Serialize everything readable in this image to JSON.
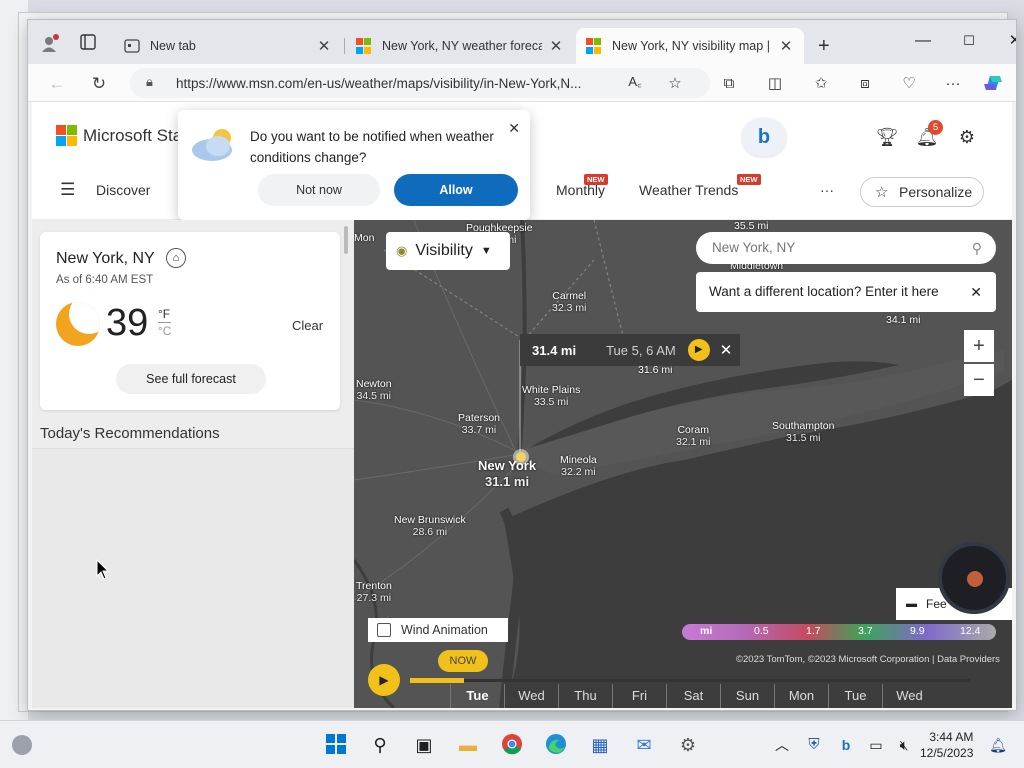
{
  "browser": {
    "tabs": [
      {
        "label": "New tab",
        "active": false
      },
      {
        "label": "New York, NY weather forecast",
        "active": false
      },
      {
        "label": "New York, NY visibility map | M",
        "active": true
      }
    ],
    "url": "https://www.msn.com/en-us/weather/maps/visibility/in-New-York,N..."
  },
  "header": {
    "logo_text": "Microsoft Sta",
    "notification_count": "5",
    "nav": [
      {
        "label": "Discover"
      },
      {
        "label": "Monthly",
        "tag": "NEW"
      },
      {
        "label": "Weather Trends",
        "tag": "NEW"
      }
    ],
    "more": "···",
    "personalize_label": "Personalize"
  },
  "notification_popup": {
    "message": "Do you want to be notified when weather conditions change?",
    "decline_label": "Not now",
    "accept_label": "Allow"
  },
  "weather_card": {
    "city": "New York, NY",
    "as_of": "As of 6:40 AM EST",
    "temperature": "39",
    "unit_f": "°F",
    "unit_c": "°C",
    "condition": "Clear",
    "forecast_button": "See full forecast"
  },
  "recommendations_title": "Today's Recommendations",
  "map": {
    "layer_label": "Visibility",
    "search_placeholder": "New York, NY",
    "location_tip": "Want a different location? Enter it here",
    "readout": {
      "value": "31.4 mi",
      "time": "Tue 5, 6 AM"
    },
    "cities": [
      {
        "name": "Poughkeepsie",
        "value": "35.2 mi"
      },
      {
        "name": "Carmel",
        "value": "32.3 mi"
      },
      {
        "name": "White Plains",
        "value": "33.5 mi"
      },
      {
        "name": "Newton",
        "value": "34.5 mi"
      },
      {
        "name": "Paterson",
        "value": "33.7 mi"
      },
      {
        "name": "New York",
        "value": "31.1 mi"
      },
      {
        "name": "Mineola",
        "value": "32.2 mi"
      },
      {
        "name": "Coram",
        "value": "32.1 mi"
      },
      {
        "name": "Southampton",
        "value": "31.5 mi"
      },
      {
        "name": "New Brunswick",
        "value": "28.6 mi"
      },
      {
        "name": "Trenton",
        "value": "27.3 mi"
      },
      {
        "name": "Middletown",
        "value": ""
      }
    ],
    "partial_labels": {
      "top": "35.5 mi",
      "right": "34.1 mi",
      "mid": "31.6 mi",
      "left_top": "Mon"
    },
    "wind_animation_label": "Wind Animation",
    "feedback_label": "Fee",
    "legend": {
      "unit": "mi",
      "stops": [
        "0.5",
        "1.7",
        "3.7",
        "9.9",
        "12.4"
      ]
    },
    "copyright": "©2023 TomTom, ©2023 Microsoft Corporation | Data Providers",
    "timeline": {
      "now_label": "NOW",
      "days": [
        "Tue",
        "Wed",
        "Thu",
        "Fri",
        "Sat",
        "Sun",
        "Mon",
        "Tue",
        "Wed"
      ]
    }
  },
  "taskbar": {
    "time": "3:44 AM",
    "date": "12/5/2023"
  }
}
